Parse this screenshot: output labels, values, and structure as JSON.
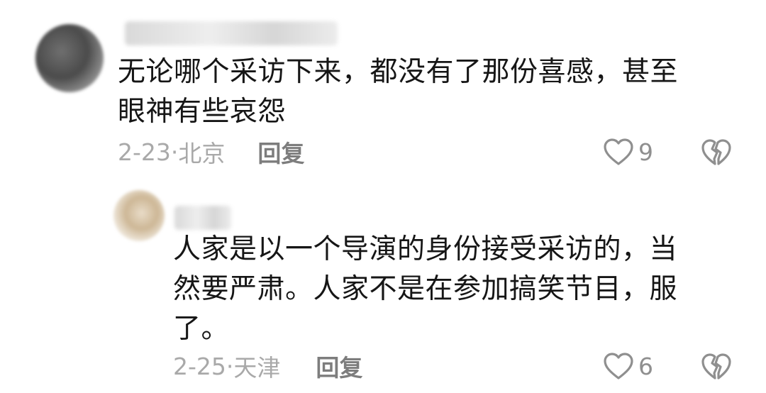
{
  "comments": [
    {
      "text_line1": "无论哪个采访下来，都没有了那份喜感，甚至",
      "text_line2": "眼神有些哀怨",
      "date": "2-23",
      "separator": "·",
      "location": "北京",
      "reply_label": "回复",
      "likes": "9"
    },
    {
      "text_line1": "人家是以一个导演的身份接受采访的，当",
      "text_line2": "然要严肃。人家不是在参加搞笑节目，服",
      "text_line3": "了。",
      "date": "2-25",
      "separator": "·",
      "location": "天津",
      "reply_label": "回复",
      "likes": "6"
    }
  ],
  "colors": {
    "text": "#161616",
    "meta": "#a9a9a9",
    "reply": "#7d7d7d",
    "icon": "#8f8f8f"
  },
  "icons": {
    "like": "heart-outline-icon",
    "dislike": "broken-heart-icon"
  }
}
